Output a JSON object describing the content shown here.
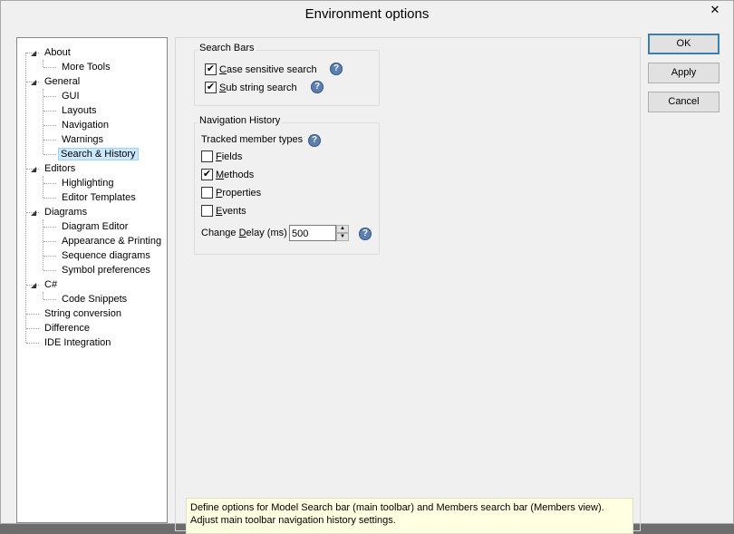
{
  "window": {
    "title": "Environment options",
    "close_glyph": "✕"
  },
  "tree": {
    "items": [
      {
        "label": "About",
        "level": 0,
        "expanded": true
      },
      {
        "label": "More Tools",
        "level": 1
      },
      {
        "label": "General",
        "level": 0,
        "expanded": true
      },
      {
        "label": "GUI",
        "level": 1
      },
      {
        "label": "Layouts",
        "level": 1
      },
      {
        "label": "Navigation",
        "level": 1
      },
      {
        "label": "Warnings",
        "level": 1
      },
      {
        "label": "Search & History",
        "level": 1,
        "selected": true
      },
      {
        "label": "Editors",
        "level": 0,
        "expanded": true
      },
      {
        "label": "Highlighting",
        "level": 1
      },
      {
        "label": "Editor Templates",
        "level": 1
      },
      {
        "label": "Diagrams",
        "level": 0,
        "expanded": true
      },
      {
        "label": "Diagram Editor",
        "level": 1
      },
      {
        "label": "Appearance & Printing",
        "level": 1
      },
      {
        "label": "Sequence diagrams",
        "level": 1
      },
      {
        "label": "Symbol preferences",
        "level": 1
      },
      {
        "label": "C#",
        "level": 0,
        "expanded": true
      },
      {
        "label": "Code Snippets",
        "level": 1
      },
      {
        "label": "String conversion",
        "level": 0
      },
      {
        "label": "Difference",
        "level": 0
      },
      {
        "label": "IDE Integration",
        "level": 0
      }
    ]
  },
  "search_bars": {
    "title": "Search Bars",
    "case_sensitive": {
      "pre": "",
      "acc": "C",
      "post": "ase sensitive search",
      "checked": true
    },
    "sub_string": {
      "pre": "",
      "acc": "S",
      "post": "ub string search",
      "checked": true
    }
  },
  "nav_history": {
    "title": "Navigation History",
    "tracked_label": "Tracked member types",
    "fields": {
      "acc": "F",
      "post": "ields",
      "checked": false
    },
    "methods": {
      "acc": "M",
      "post": "ethods",
      "checked": true
    },
    "properties": {
      "acc": "P",
      "post": "roperties",
      "checked": false
    },
    "events": {
      "acc": "E",
      "post": "vents",
      "checked": false
    },
    "delay_pre": "Change ",
    "delay_acc": "D",
    "delay_post": "elay (ms)",
    "delay_value": "500"
  },
  "buttons": {
    "ok": "OK",
    "apply": "Apply",
    "cancel": "Cancel"
  },
  "help_glyph": "?",
  "check_glyph": "✔",
  "spin_up_glyph": "▲",
  "spin_down_glyph": "▼",
  "expander_glyph": "◢",
  "description": {
    "line1": "Define options for Model Search bar (main toolbar) and Members search bar (Members view).",
    "line2": "Adjust main toolbar navigation history settings."
  },
  "colors": {
    "accent": "#3c7fb1",
    "selection": "#cce8ff",
    "help": "#5a7fb0",
    "tooltip_bg": "#ffffe1"
  }
}
